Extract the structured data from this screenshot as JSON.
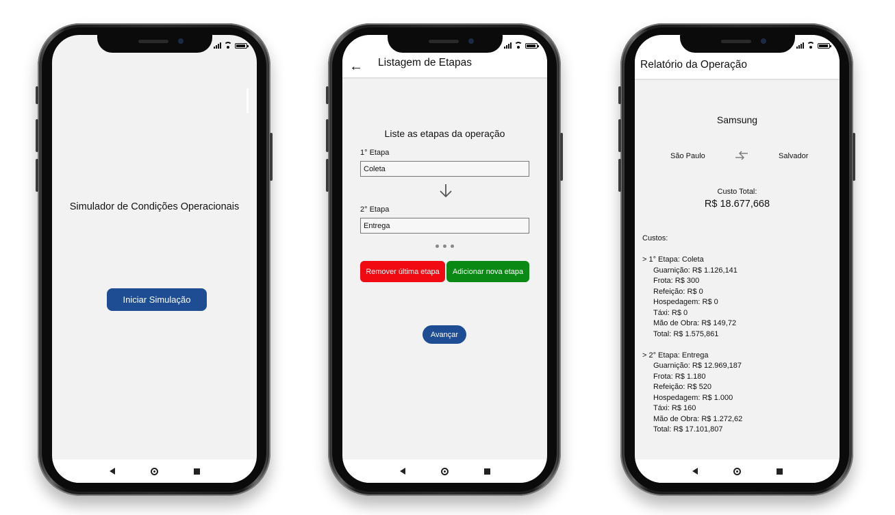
{
  "screens": {
    "home": {
      "title": "Simulador de Condições Operacionais",
      "start_button": "Iniciar Simulação"
    },
    "stages": {
      "appbar_title": "Listagem de Etapas",
      "prompt": "Liste as etapas da operação",
      "stage1_label": "1° Etapa",
      "stage1_value": "Coleta",
      "stage2_label": "2° Etapa",
      "stage2_value": "Entrega",
      "remove_button": "Remover última etapa",
      "add_button": "Adicionar nova etapa",
      "next_button": "Avançar"
    },
    "report": {
      "appbar_title": "Relatório da Operação",
      "company": "Samsung",
      "origin": "São Paulo",
      "destination": "Salvador",
      "total_label": "Custo Total:",
      "total_value": "R$ 18.677,668",
      "costs_label": "Custos:",
      "stage1_header": "> 1° Etapa: Coleta",
      "stage1_lines": [
        "Guarnição: R$ 1.126,141",
        "Frota: R$ 300",
        "Refeição: R$ 0",
        "Hospedagem: R$ 0",
        "Táxi: R$ 0",
        "Mão de Obra: R$ 149,72",
        "Total: R$ 1.575,861"
      ],
      "stage2_header": "> 2° Etapa: Entrega",
      "stage2_lines": [
        "Guarnição: R$ 12.969,187",
        "Frota: R$ 1.180",
        "Refeição: R$ 520",
        "Hospedagem: R$ 1.000",
        "Táxi: R$ 160",
        "Mão de Obra: R$ 1.272,62",
        "Total: R$ 17.101,807"
      ]
    }
  },
  "icons": {
    "back": "arrow-left-icon",
    "down": "arrow-down-icon",
    "swap": "swap-arrows-icon",
    "nav_back": "triangle-back-icon",
    "nav_home": "circle-home-icon",
    "nav_recent": "square-recent-icon"
  },
  "colors": {
    "primary_blue": "#1e4d94",
    "remove_red": "#f10a12",
    "add_green": "#0a8a14",
    "screen_bg": "#f2f2f2"
  }
}
